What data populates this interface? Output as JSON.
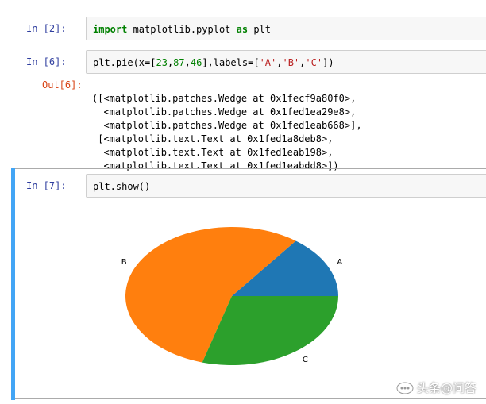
{
  "cells": {
    "c2": {
      "prompt": "In  [2]:",
      "keyword1": "import",
      "module": " matplotlib.pyplot ",
      "keyword2": "as",
      "alias": " plt"
    },
    "c6": {
      "prompt": "In  [6]:",
      "code_prefix": "plt.pie(",
      "arg_name": "x",
      "code_eq": "=[",
      "n1": "23",
      "n2": "87",
      "n3": "46",
      "code_mid": "],labels=[",
      "s1": "'A'",
      "s2": "'B'",
      "s3": "'C'",
      "code_end": "])",
      "out_prompt": "Out[6]:",
      "output_lines": [
        "([<matplotlib.patches.Wedge at 0x1fecf9a80f0>,",
        "  <matplotlib.patches.Wedge at 0x1fed1ea29e8>,",
        "  <matplotlib.patches.Wedge at 0x1fed1eab668>],",
        " [<matplotlib.text.Text at 0x1fed1a8deb8>,",
        "  <matplotlib.text.Text at 0x1fed1eab198>,",
        "  <matplotlib.text.Text at 0x1fed1eabdd8>])"
      ]
    },
    "c7": {
      "prompt": "In  [7]:",
      "code": "plt.show()"
    }
  },
  "chart_data": {
    "type": "pie",
    "categories": [
      "A",
      "B",
      "C"
    ],
    "values": [
      23,
      87,
      46
    ],
    "colors": [
      "#1f77b4",
      "#ff7f0e",
      "#2ca02c"
    ]
  },
  "watermark": {
    "text": "头条@问答",
    "icon": "toutiao-logo-icon"
  }
}
